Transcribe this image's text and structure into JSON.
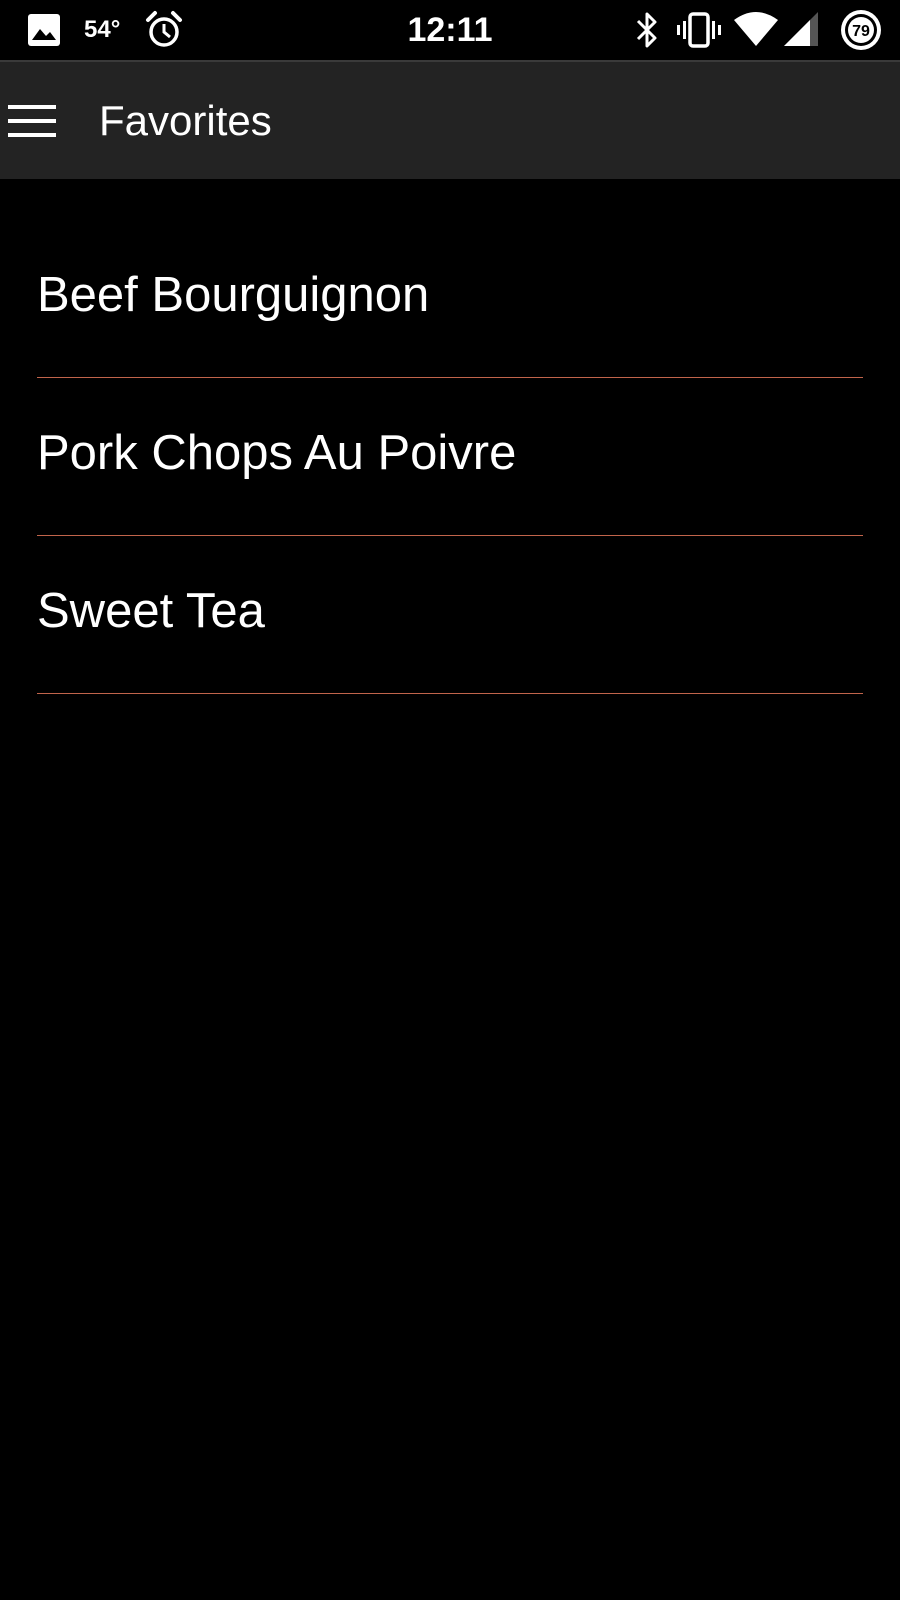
{
  "status_bar": {
    "temperature": "54°",
    "time": "12:11",
    "battery_level": "79",
    "icons": [
      "image-icon",
      "alarm-icon",
      "bluetooth-icon",
      "vibrate-icon",
      "wifi-icon",
      "cell-signal-icon",
      "battery-icon"
    ]
  },
  "toolbar": {
    "title": "Favorites",
    "menu_icon": "hamburger-menu-icon"
  },
  "favorites": {
    "items": [
      {
        "label": "Beef Bourguignon"
      },
      {
        "label": "Pork Chops Au Poivre"
      },
      {
        "label": "Sweet Tea"
      }
    ]
  },
  "colors": {
    "background": "#000000",
    "toolbar": "#232323",
    "divider": "#c1644b",
    "text": "#ffffff"
  }
}
